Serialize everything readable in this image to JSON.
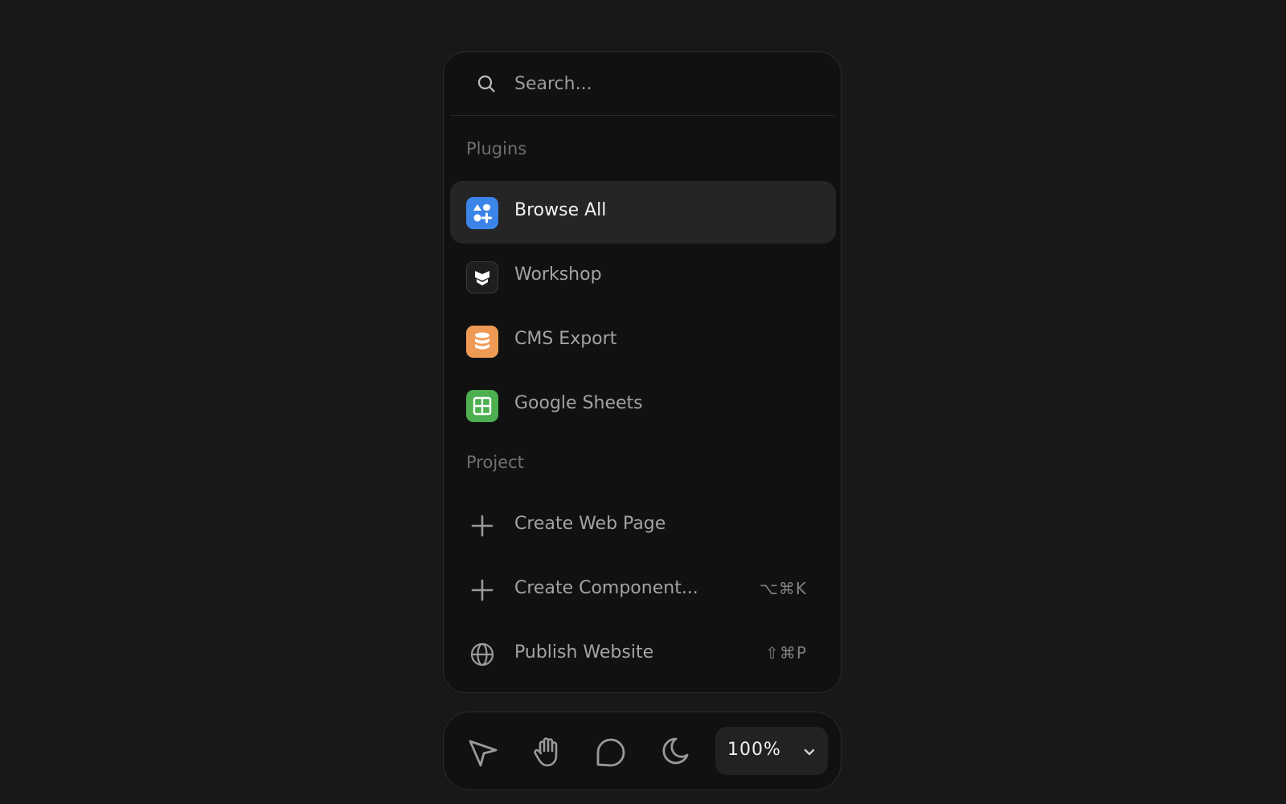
{
  "search": {
    "placeholder": "Search..."
  },
  "sections": {
    "plugins": {
      "label": "Plugins",
      "items": [
        {
          "label": "Browse All",
          "icon": "browse-all-icon",
          "color": "#3b84e8",
          "active": true
        },
        {
          "label": "Workshop",
          "icon": "workshop-icon",
          "color": "#1e1e1e"
        },
        {
          "label": "CMS Export",
          "icon": "database-icon",
          "color": "#ee9a55"
        },
        {
          "label": "Google Sheets",
          "icon": "sheets-grid-icon",
          "color": "#4caf50"
        }
      ]
    },
    "project": {
      "label": "Project",
      "items": [
        {
          "label": "Create Web Page",
          "icon": "plus-icon"
        },
        {
          "label": "Create Component...",
          "icon": "plus-icon",
          "shortcut": "⌥⌘K"
        },
        {
          "label": "Publish Website",
          "icon": "globe-icon",
          "shortcut": "⇧⌘P"
        }
      ]
    }
  },
  "toolbar": {
    "tools": [
      "cursor-icon",
      "hand-icon",
      "comment-icon",
      "moon-icon"
    ],
    "zoom": "100%"
  },
  "colors": {
    "background": "#181818",
    "panel": "#111111",
    "active_row": "#252525"
  }
}
